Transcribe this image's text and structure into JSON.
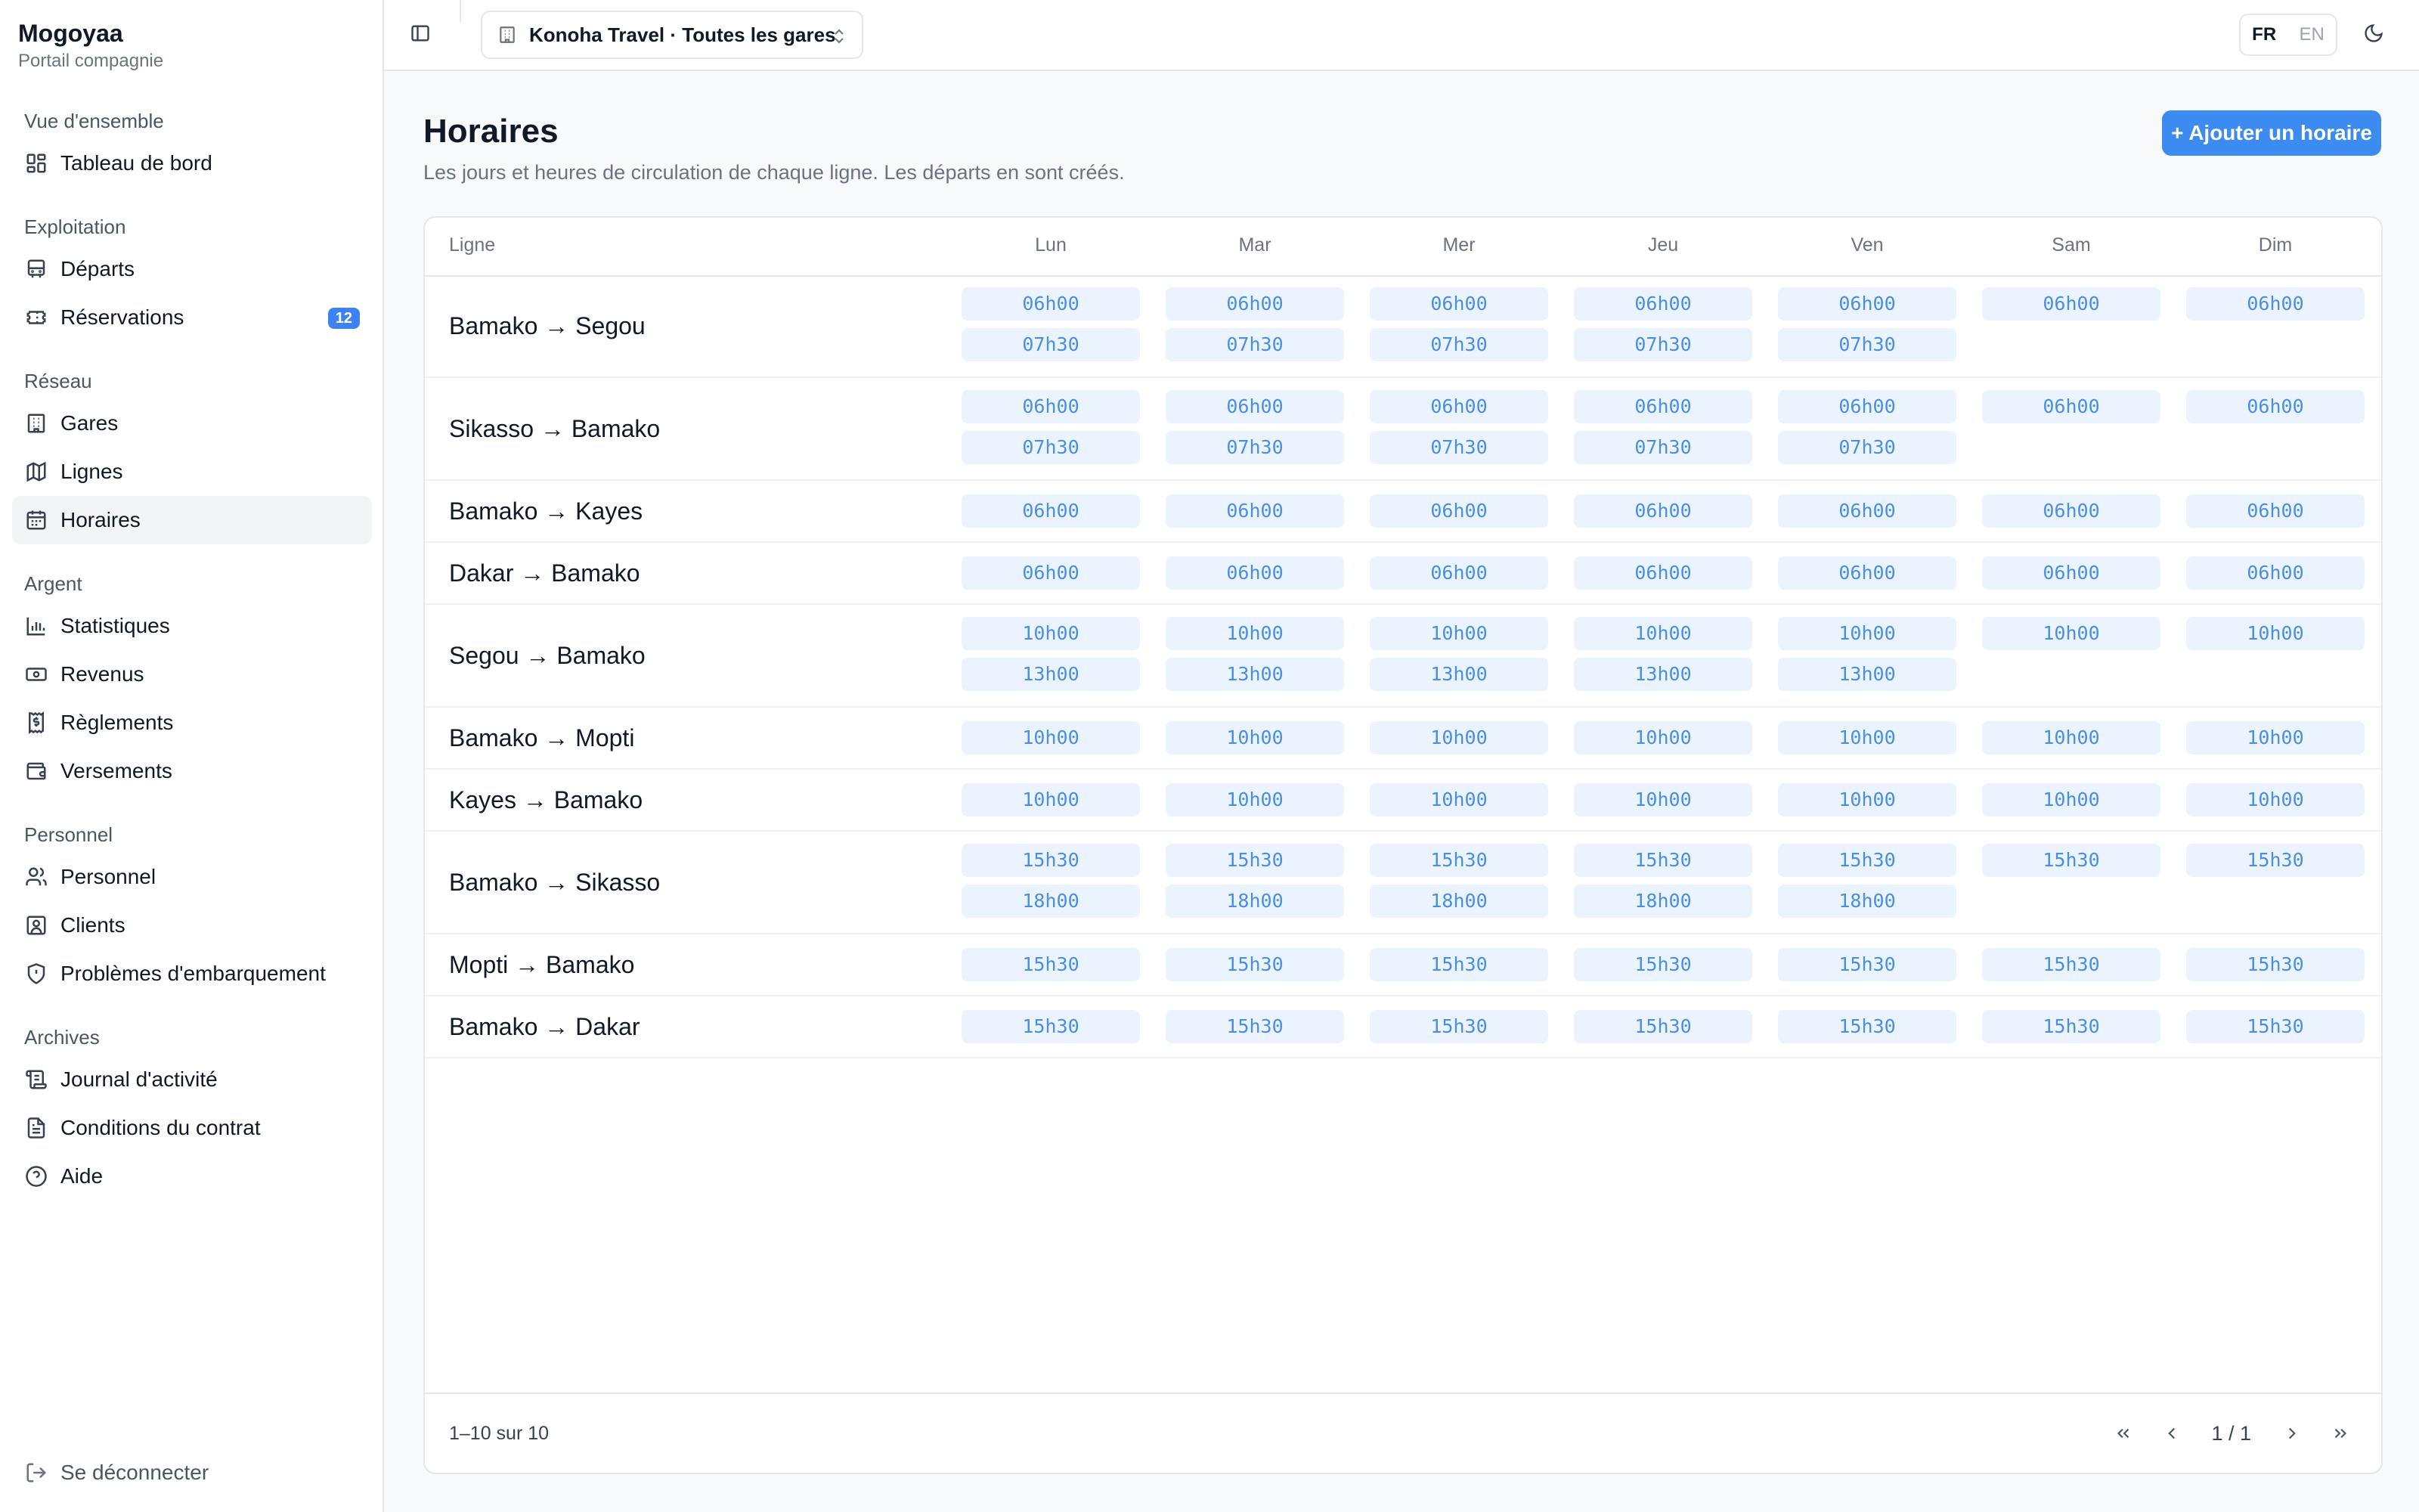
{
  "app": {
    "name": "Mogoyaa",
    "subtitle": "Portail compagnie"
  },
  "sidebar": {
    "groups": [
      {
        "title": "Vue d'ensemble",
        "items": [
          {
            "label": "Tableau de bord",
            "icon": "dashboard-icon"
          }
        ]
      },
      {
        "title": "Exploitation",
        "items": [
          {
            "label": "Départs",
            "icon": "bus-icon"
          },
          {
            "label": "Réservations",
            "icon": "ticket-icon",
            "badge": "12"
          }
        ]
      },
      {
        "title": "Réseau",
        "items": [
          {
            "label": "Gares",
            "icon": "building-icon"
          },
          {
            "label": "Lignes",
            "icon": "map-icon"
          },
          {
            "label": "Horaires",
            "icon": "calendar-icon",
            "active": true
          }
        ]
      },
      {
        "title": "Argent",
        "items": [
          {
            "label": "Statistiques",
            "icon": "chart-icon"
          },
          {
            "label": "Revenus",
            "icon": "banknote-icon"
          },
          {
            "label": "Règlements",
            "icon": "receipt-icon"
          },
          {
            "label": "Versements",
            "icon": "wallet-icon"
          }
        ]
      },
      {
        "title": "Personnel",
        "items": [
          {
            "label": "Personnel",
            "icon": "users-icon"
          },
          {
            "label": "Clients",
            "icon": "contact-icon"
          },
          {
            "label": "Problèmes d'embarquement",
            "icon": "shield-icon"
          }
        ]
      },
      {
        "title": "Archives",
        "items": [
          {
            "label": "Journal d'activité",
            "icon": "scroll-icon"
          },
          {
            "label": "Conditions du contrat",
            "icon": "document-icon"
          },
          {
            "label": "Aide",
            "icon": "help-icon"
          }
        ]
      }
    ],
    "logout_label": "Se déconnecter"
  },
  "topbar": {
    "org_selector": "Konoha Travel · Toutes les gares",
    "lang": {
      "fr": "FR",
      "en": "EN",
      "selected": "FR"
    }
  },
  "page": {
    "title": "Horaires",
    "description": "Les jours et heures de circulation de chaque ligne. Les départs en sont créés.",
    "add_button": "+ Ajouter un horaire"
  },
  "table": {
    "line_header": "Ligne",
    "days": [
      "Lun",
      "Mar",
      "Mer",
      "Jeu",
      "Ven",
      "Sam",
      "Dim"
    ],
    "rows": [
      {
        "line": "Bamako → Segou",
        "times": [
          [
            "06h00",
            "07h30"
          ],
          [
            "06h00",
            "07h30"
          ],
          [
            "06h00",
            "07h30"
          ],
          [
            "06h00",
            "07h30"
          ],
          [
            "06h00",
            "07h30"
          ],
          [
            "06h00"
          ],
          [
            "06h00"
          ]
        ]
      },
      {
        "line": "Sikasso → Bamako",
        "times": [
          [
            "06h00",
            "07h30"
          ],
          [
            "06h00",
            "07h30"
          ],
          [
            "06h00",
            "07h30"
          ],
          [
            "06h00",
            "07h30"
          ],
          [
            "06h00",
            "07h30"
          ],
          [
            "06h00"
          ],
          [
            "06h00"
          ]
        ]
      },
      {
        "line": "Bamako → Kayes",
        "times": [
          [
            "06h00"
          ],
          [
            "06h00"
          ],
          [
            "06h00"
          ],
          [
            "06h00"
          ],
          [
            "06h00"
          ],
          [
            "06h00"
          ],
          [
            "06h00"
          ]
        ]
      },
      {
        "line": "Dakar → Bamako",
        "times": [
          [
            "06h00"
          ],
          [
            "06h00"
          ],
          [
            "06h00"
          ],
          [
            "06h00"
          ],
          [
            "06h00"
          ],
          [
            "06h00"
          ],
          [
            "06h00"
          ]
        ]
      },
      {
        "line": "Segou → Bamako",
        "times": [
          [
            "10h00",
            "13h00"
          ],
          [
            "10h00",
            "13h00"
          ],
          [
            "10h00",
            "13h00"
          ],
          [
            "10h00",
            "13h00"
          ],
          [
            "10h00",
            "13h00"
          ],
          [
            "10h00"
          ],
          [
            "10h00"
          ]
        ]
      },
      {
        "line": "Bamako → Mopti",
        "times": [
          [
            "10h00"
          ],
          [
            "10h00"
          ],
          [
            "10h00"
          ],
          [
            "10h00"
          ],
          [
            "10h00"
          ],
          [
            "10h00"
          ],
          [
            "10h00"
          ]
        ]
      },
      {
        "line": "Kayes → Bamako",
        "times": [
          [
            "10h00"
          ],
          [
            "10h00"
          ],
          [
            "10h00"
          ],
          [
            "10h00"
          ],
          [
            "10h00"
          ],
          [
            "10h00"
          ],
          [
            "10h00"
          ]
        ]
      },
      {
        "line": "Bamako → Sikasso",
        "times": [
          [
            "15h30",
            "18h00"
          ],
          [
            "15h30",
            "18h00"
          ],
          [
            "15h30",
            "18h00"
          ],
          [
            "15h30",
            "18h00"
          ],
          [
            "15h30",
            "18h00"
          ],
          [
            "15h30"
          ],
          [
            "15h30"
          ]
        ]
      },
      {
        "line": "Mopti → Bamako",
        "times": [
          [
            "15h30"
          ],
          [
            "15h30"
          ],
          [
            "15h30"
          ],
          [
            "15h30"
          ],
          [
            "15h30"
          ],
          [
            "15h30"
          ],
          [
            "15h30"
          ]
        ]
      },
      {
        "line": "Bamako → Dakar",
        "times": [
          [
            "15h30"
          ],
          [
            "15h30"
          ],
          [
            "15h30"
          ],
          [
            "15h30"
          ],
          [
            "15h30"
          ],
          [
            "15h30"
          ],
          [
            "15h30"
          ]
        ]
      }
    ],
    "footer_count": "1–10 sur 10",
    "page_indicator": "1 / 1"
  },
  "colors": {
    "accent": "#3b8bf0",
    "pill_bg": "#eaf3fe",
    "pill_text": "#4a90e2",
    "badge": "#3b82f6"
  }
}
